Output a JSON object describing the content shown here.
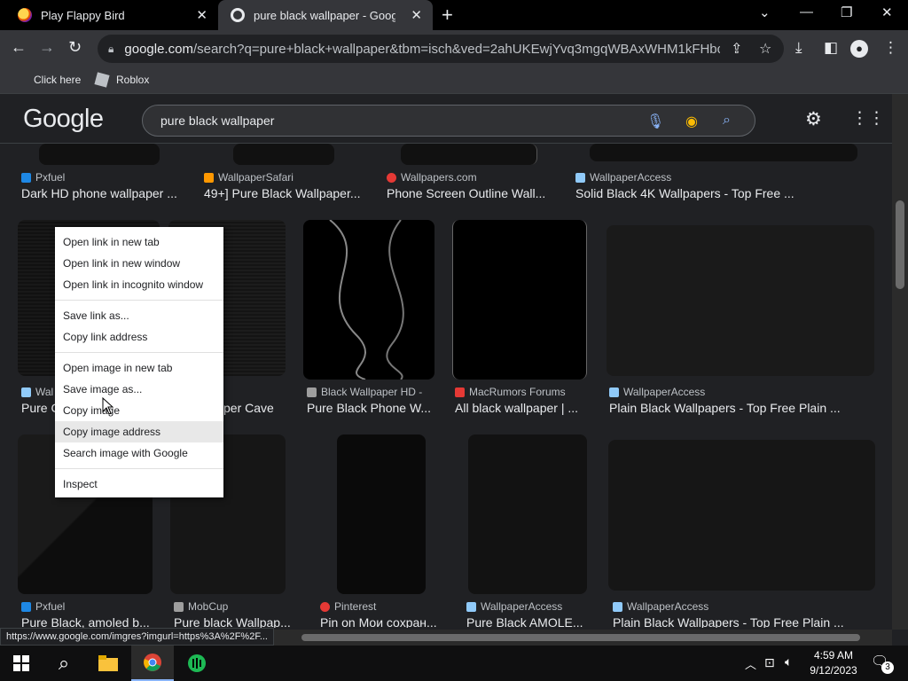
{
  "browser": {
    "tabs": [
      {
        "title": "Play Flappy Bird",
        "active": false
      },
      {
        "title": "pure black wallpaper - Google Se",
        "active": true
      }
    ],
    "url_domain": "google.com",
    "url_rest": "/search?q=pure+black+wallpaper&tbm=isch&ved=2ahUKEwjYvq3mgqWBAxWHM1kFHbckBuE...",
    "bookmarks": [
      "Click here",
      "Roblox"
    ]
  },
  "google": {
    "logo": "Google",
    "query": "pure black wallpaper"
  },
  "results": {
    "row1": [
      {
        "source": "Pxfuel",
        "title": "Dark HD phone wallpaper ...",
        "src_color": "#1e88e5"
      },
      {
        "source": "WallpaperSafari",
        "title": "49+] Pure Black Wallpaper...",
        "src_color": "#ff9800"
      },
      {
        "source": "Wallpapers.com",
        "title": "Phone Screen Outline Wall...",
        "src_color": "#e53935"
      },
      {
        "source": "WallpaperAccess",
        "title": "Solid Black 4K Wallpapers - Top Free ...",
        "src_color": "#90caf9"
      }
    ],
    "row2": [
      {
        "source": "Wal",
        "title": "Pure C",
        "src_color": "#90caf9"
      },
      {
        "source": "",
        "title": "per Cave",
        "src_color": "#444"
      },
      {
        "source": "Black Wallpaper HD -",
        "title": "Pure Black Phone W...",
        "src_color": "#9e9e9e"
      },
      {
        "source": "MacRumors Forums",
        "title": "All black wallpaper | ...",
        "src_color": "#e53935"
      },
      {
        "source": "WallpaperAccess",
        "title": "Plain Black Wallpapers - Top Free Plain ...",
        "src_color": "#90caf9"
      }
    ],
    "row3": [
      {
        "source": "Pxfuel",
        "title": "Pure Black, amoled b...",
        "src_color": "#1e88e5"
      },
      {
        "source": "MobCup",
        "title": "Pure black Wallpap...",
        "src_color": "#9e9e9e"
      },
      {
        "source": "Pinterest",
        "title": "Pin on Мои сохран...",
        "src_color": "#e53935"
      },
      {
        "source": "WallpaperAccess",
        "title": "Pure Black AMOLE...",
        "src_color": "#90caf9"
      },
      {
        "source": "WallpaperAccess",
        "title": "Plain Black Wallpapers - Top Free Plain ...",
        "src_color": "#90caf9"
      }
    ]
  },
  "context_menu": {
    "groups": [
      [
        "Open link in new tab",
        "Open link in new window",
        "Open link in incognito window"
      ],
      [
        "Save link as...",
        "Copy link address"
      ],
      [
        "Open image in new tab",
        "Save image as...",
        "Copy image",
        "Copy image address",
        "Search image with Google"
      ],
      [
        "Inspect"
      ]
    ],
    "highlighted": "Copy image address"
  },
  "status_url": "https://www.google.com/imgres?imgurl=https%3A%2F%2F...",
  "taskbar": {
    "time": "4:59 AM",
    "date": "9/12/2023",
    "notification_count": "3"
  },
  "colors": {
    "accent": "#8ab4f8",
    "background": "#202124"
  }
}
